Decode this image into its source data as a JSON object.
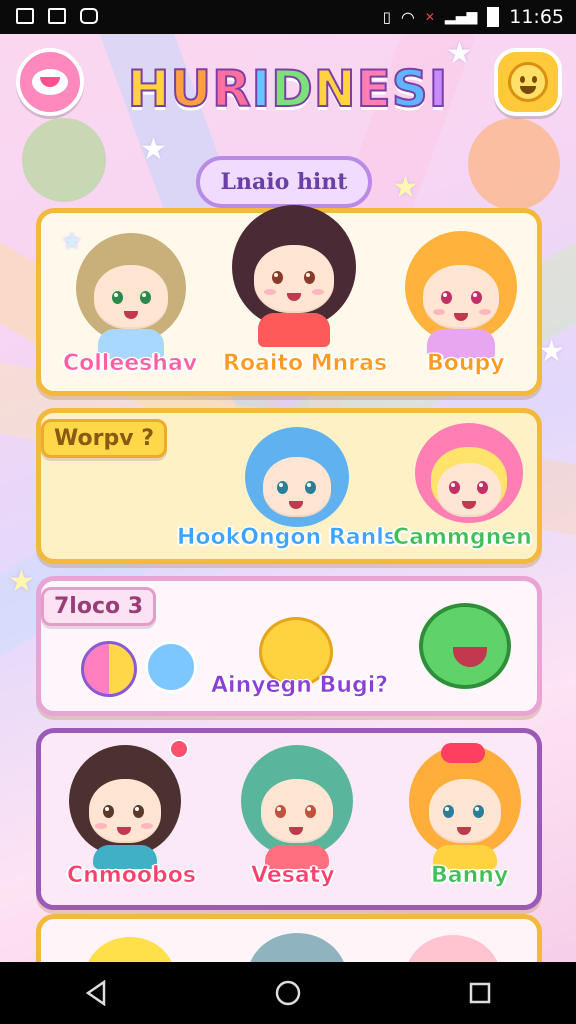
{
  "status_bar": {
    "time": "11:65",
    "left_icons": [
      "image-icon",
      "image-icon",
      "gamepad-icon"
    ],
    "right_icons": [
      "vibrate-icon",
      "wifi-icon",
      "mute-icon",
      "signal-icon",
      "battery-icon"
    ]
  },
  "header": {
    "title_letters": [
      "H",
      "U",
      "R",
      "I",
      "D",
      "N",
      "E",
      "S",
      "I"
    ],
    "left_button_icon": "pink-face-icon",
    "right_button_icon": "smiley-icon",
    "cloud_label": "Lnaio hint"
  },
  "cards": [
    {
      "characters": [
        {
          "name": "Colleeshav",
          "color": "#ff5fa2"
        },
        {
          "name": "Roaito Mnras",
          "color": "#ff9a1f"
        },
        {
          "name": "Boupy",
          "color": "#ff9a1f"
        }
      ]
    },
    {
      "tag": "Worpv ?",
      "characters": [
        {
          "name": "HookOngon Ranls",
          "color": "#3ea2ff"
        },
        {
          "name": "Cammgnen",
          "color": "#3fbf56"
        }
      ]
    },
    {
      "tag": "7loco 3",
      "label": "Ainyegn Bugi?",
      "label_color": "#8a3fd6"
    },
    {
      "characters": [
        {
          "name": "Cnmoobos",
          "color": "#ff3f6d"
        },
        {
          "name": "Vesaty",
          "color": "#ff3f6d"
        },
        {
          "name": "Banny",
          "color": "#3fbf56"
        }
      ]
    }
  ],
  "nav": [
    "back-icon",
    "home-icon",
    "recents-icon"
  ],
  "colors": {
    "card_border": "#f2b93a",
    "accent": "#9b5ab8"
  }
}
